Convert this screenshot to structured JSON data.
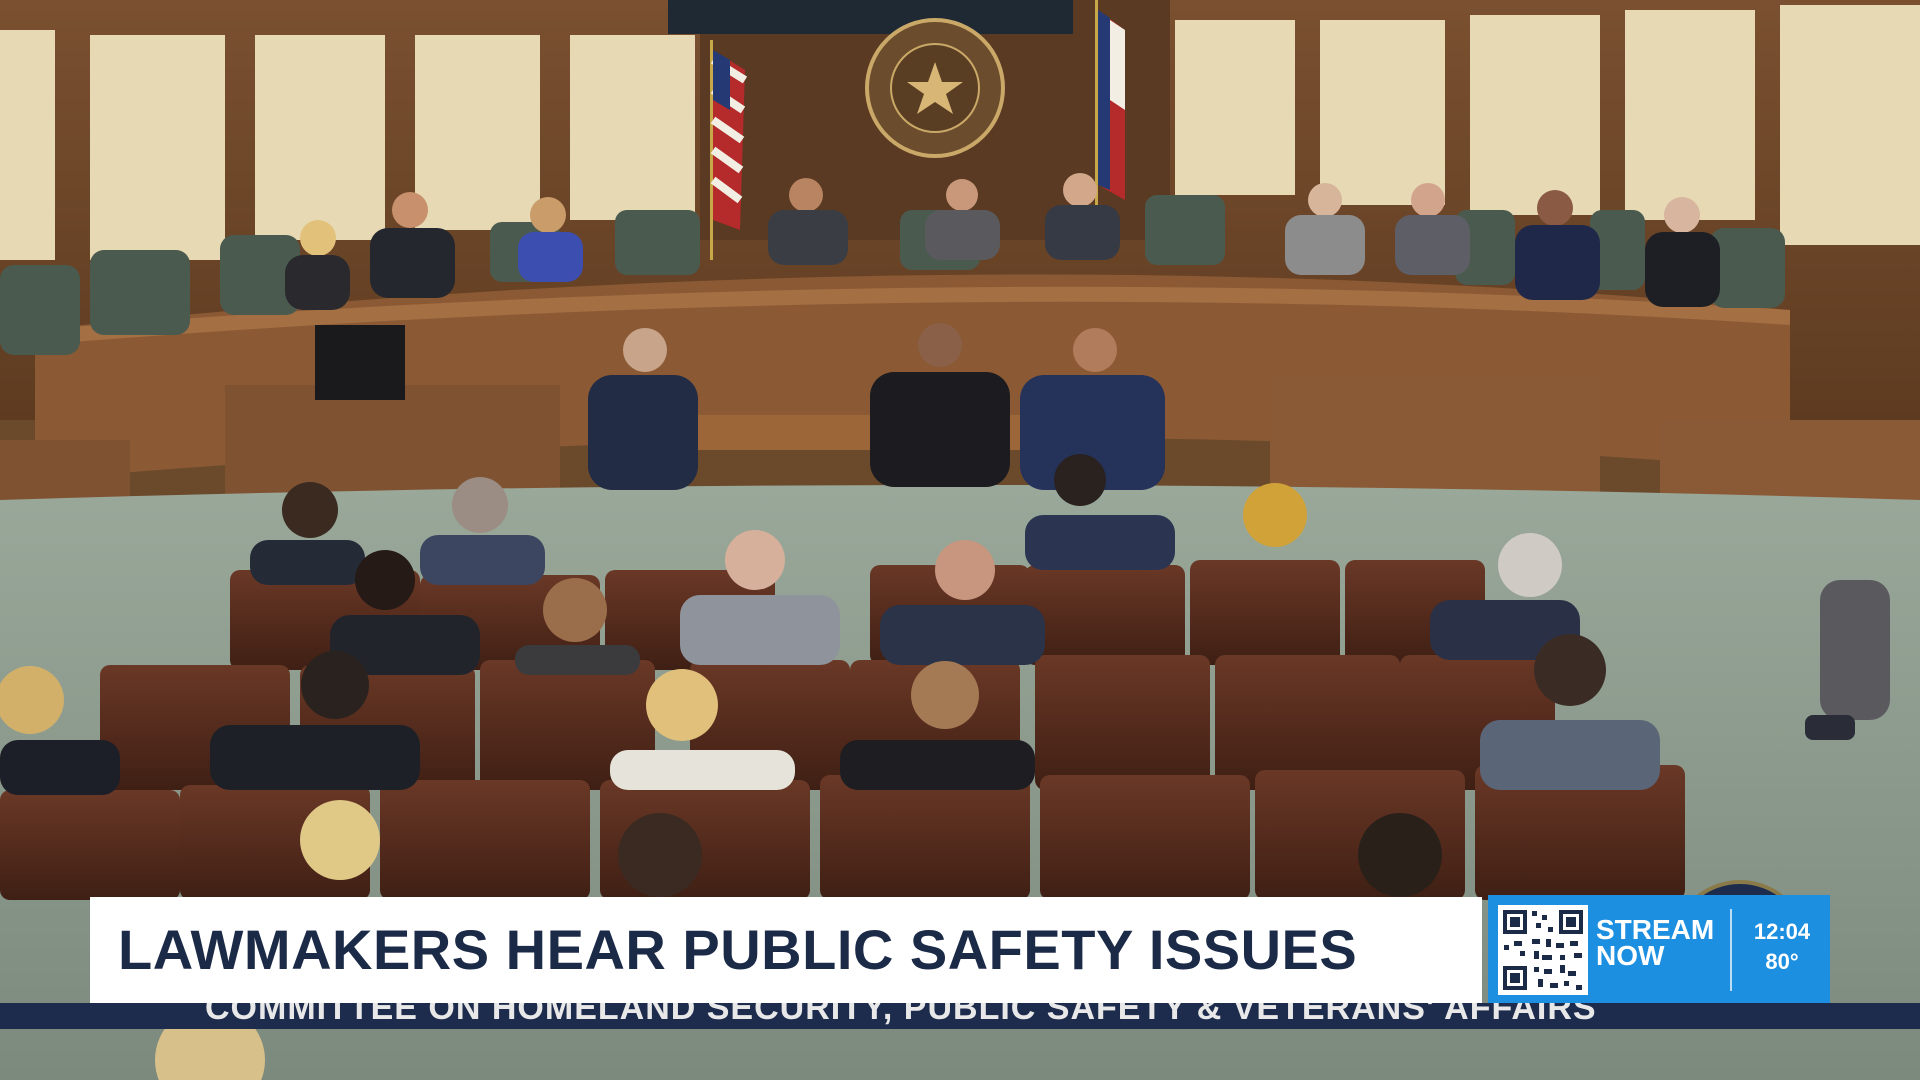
{
  "broadcast": {
    "headline": "LAWMAKERS HEAR PUBLIC SAFETY ISSUES",
    "stream_line1": "STREAM",
    "stream_line2": "NOW",
    "time": "12:04",
    "temperature": "80°",
    "source_caption": "COMMITTEE ON HOMELAND SECURITY, PUBLIC SAFETY & VETERANS' AFFAIRS"
  },
  "colors": {
    "headline_text": "#1b2a47",
    "stream_badge": "#1d8fe0",
    "ticker_band": "#1d2c4d"
  },
  "icons": [
    "qr-code-icon",
    "state-seal-icon",
    "us-flag-icon",
    "texas-flag-icon"
  ]
}
